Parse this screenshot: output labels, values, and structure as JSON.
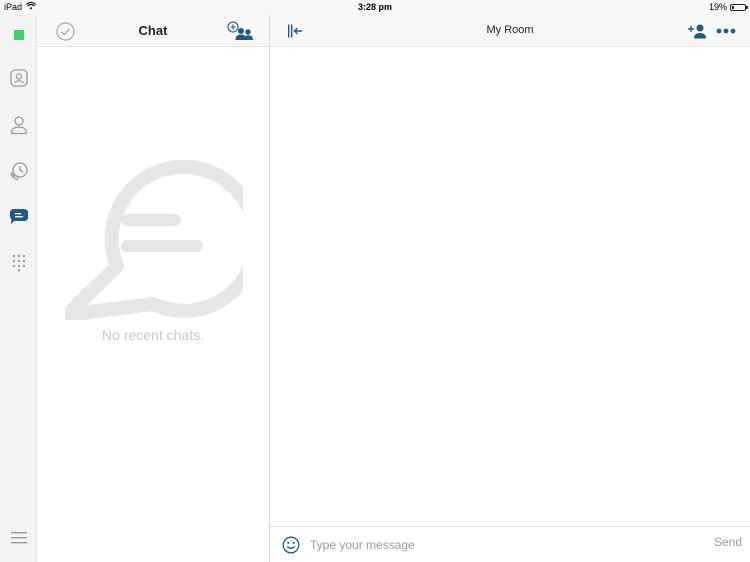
{
  "status_bar": {
    "device": "iPad",
    "time": "3:28 pm",
    "battery": "19%",
    "battery_level": 0.19
  },
  "rail": {
    "items": [
      {
        "icon": "presence-status-icon",
        "color": "#3ecf6e"
      },
      {
        "icon": "contact-card-icon"
      },
      {
        "icon": "person-icon"
      },
      {
        "icon": "call-history-icon"
      },
      {
        "icon": "chat-bubble-icon",
        "active": true,
        "color": "#1f5b85"
      },
      {
        "icon": "dialpad-icon"
      },
      {
        "icon": "menu-icon"
      }
    ]
  },
  "chat_list": {
    "title": "Chat",
    "empty_message": "No recent chats.",
    "select_icon": "checkmark-circle-icon",
    "new_group_icon": "add-group-icon"
  },
  "room": {
    "title": "My Room",
    "collapse_icon": "collapse-panel-icon",
    "add_person_icon": "add-person-icon",
    "more_icon": "more-dots-icon",
    "accent": "#1f5b85"
  },
  "composer": {
    "placeholder": "Type your message",
    "value": "",
    "send_label": "Send",
    "emoji_icon": "emoji-icon"
  }
}
